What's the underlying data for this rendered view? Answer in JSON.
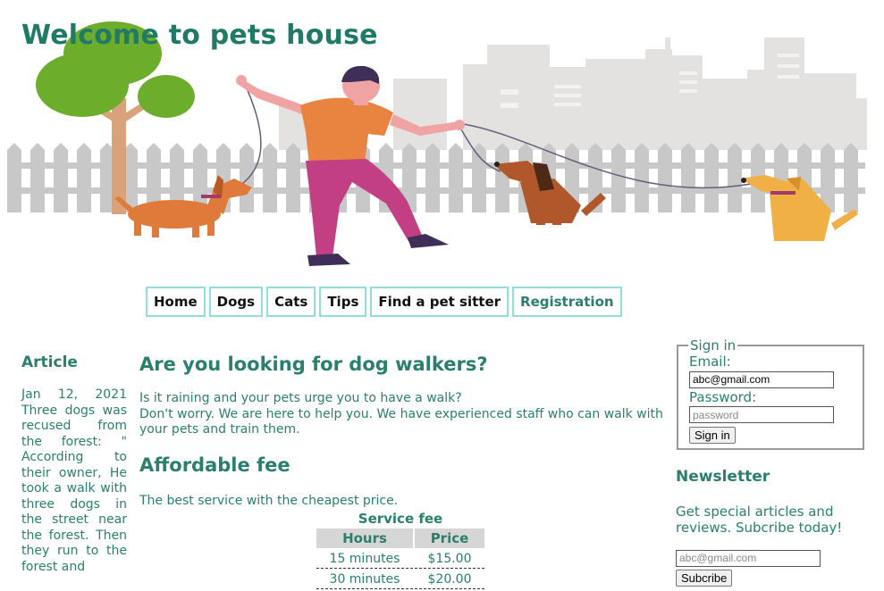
{
  "header": {
    "title": "Welcome to pets house"
  },
  "nav": {
    "items": [
      {
        "label": "Home"
      },
      {
        "label": "Dogs"
      },
      {
        "label": "Cats"
      },
      {
        "label": "Tips"
      },
      {
        "label": "Find a pet sitter"
      },
      {
        "label": "Registration"
      }
    ],
    "active_index": 5
  },
  "article": {
    "heading": "Article",
    "text": "Jan 12, 2021 Three dogs was recused from the forest: \" According to their owner, He took a walk with three dogs in the street near the forest. Then they run to the forest and"
  },
  "main": {
    "heading1": "Are you looking for dog walkers?",
    "para1_line1": "Is it raining and your pets urge you to have a walk?",
    "para1_line2": "Don't worry. We are here to help you. We have experienced staff who can walk with your pets and train them.",
    "heading2": "Affordable fee",
    "para2": "The best service with the cheapest price."
  },
  "fee_table": {
    "caption": "Service fee",
    "headers": [
      "Hours",
      "Price"
    ],
    "rows": [
      [
        "15 minutes",
        "$15.00"
      ],
      [
        "30 minutes",
        "$20.00"
      ]
    ]
  },
  "signin": {
    "legend": "Sign in",
    "email_label": "Email:",
    "email_value": "abc@gmail.com",
    "password_label": "Password:",
    "password_placeholder": "password",
    "button_label": "Sign in"
  },
  "newsletter": {
    "heading": "Newsletter",
    "text": "Get special articles and reviews. Subcribe today!",
    "email_placeholder": "abc@gmail.com",
    "button_label": "Subcribe"
  },
  "colors": {
    "heading": "#2a7f6f",
    "nav_border": "#8fe0d8",
    "fence": "#c9c9c9",
    "buildings": "#e2e2e2"
  },
  "icons": [
    "tree-illustration",
    "city-buildings",
    "fence",
    "dog-walker-person",
    "dachshund-dog",
    "brown-sitting-dog",
    "yellow-sitting-dog"
  ]
}
